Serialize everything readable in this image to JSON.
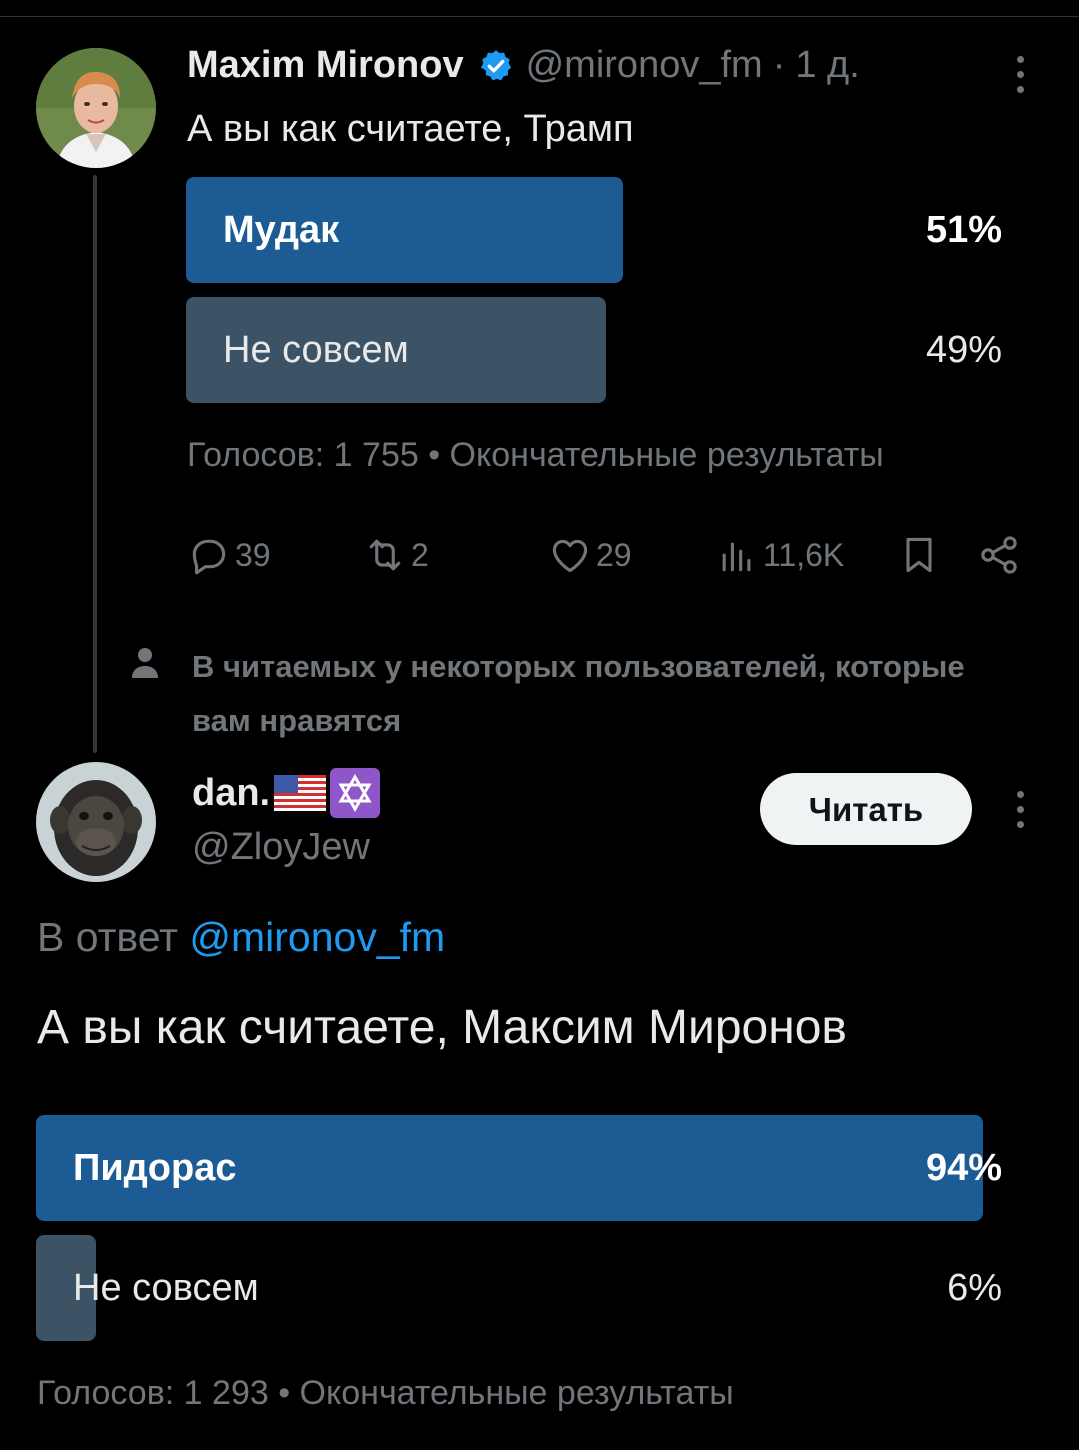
{
  "tweet1": {
    "author_name": "Maxim Mironov",
    "author_handle": "@mironov_fm",
    "separator": "·",
    "time": "1 д.",
    "text": "А вы как считаете, Трамп",
    "poll": {
      "options": [
        {
          "label": "Мудак",
          "percent": "51%",
          "fraction": 0.51
        },
        {
          "label": "Не совсем",
          "percent": "49%",
          "fraction": 0.49
        }
      ],
      "meta": "Голосов: 1 755 • Окончательные результаты"
    },
    "actions": {
      "replies": "39",
      "reposts": "2",
      "likes": "29",
      "views": "11,6K"
    }
  },
  "social_context": {
    "text": "В читаемых у некоторых пользователей, которые вам нравятся"
  },
  "tweet2": {
    "author_name": "dan.",
    "author_handle": "@ZloyJew",
    "follow_label": "Читать",
    "reply_prefix": "В ответ",
    "reply_mention": "@mironov_fm",
    "text": "А вы как считаете, Максим Миронов",
    "poll": {
      "options": [
        {
          "label": "Пидорас",
          "percent": "94%",
          "fraction": 0.94
        },
        {
          "label": "Не совсем",
          "percent": "6%",
          "fraction": 0.06
        }
      ],
      "meta": "Голосов: 1 293 • Окончательные результаты"
    }
  },
  "colors": {
    "poll_leading": "#1d5b94",
    "poll_other": "#3c5365",
    "accent": "#1d9bf0",
    "muted": "#71767b"
  }
}
